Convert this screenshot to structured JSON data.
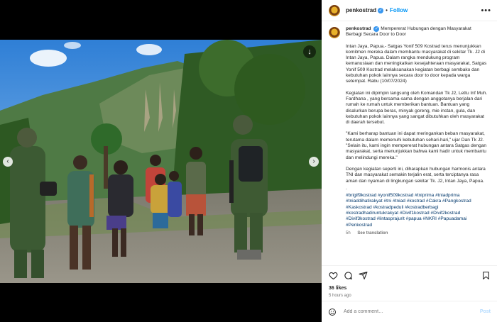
{
  "colors": {
    "accent": "#0095f6",
    "hashtag": "#00376b",
    "muted": "#737373"
  },
  "header": {
    "username": "penkostrad",
    "separator": "•",
    "follow_label": "Follow",
    "more_icon": "more-horizontal-icon"
  },
  "media": {
    "prev_icon": "chevron-left-icon",
    "next_icon": "chevron-right-icon",
    "download_icon": "download-icon"
  },
  "caption": {
    "username": "penkostrad",
    "title": "Mempererat Hubungan dengan Masyarakat Berbagi Secara Door to Door",
    "paragraph1": "Intan Jaya, Papua.- Satgas Yonif 509 Kostrad terus menunjukkan komitmen mereka dalam membantu masyarakat di sekitar Tk. J2 di Intan Jaya, Papua. Dalam rangka mendukung program kemanusiaan dan meningkatkan kesejahteraan masyarakat, Satgas Yonif 509 Kostrad melaksanakan kegiatan berbagi sembako dan kebutuhan pokok lainnya secara door to door kepada warga setempat. Rabu (10/07/2024)",
    "paragraph2": "Kegiatan ini dipimpin langsung oleh Komandan Tk J2, Lettu Inf Muh. Fardhana , yang bersama-sama dengan anggotanya berjalan dari rumah ke rumah untuk memberikan bantuan. Bantuan yang disalurkan berupa beras, minyak goreng, mie instan, gula, dan kebutuhan pokok lainnya yang sangat dibutuhkan oleh masyarakat di daerah tersebut.",
    "paragraph3": "\"Kami berharap bantuan ini dapat meringankan beban masyarakat, terutama dalam memenuhi kebutuhan sehari-hari,\" ujar Dan Tk J2. \"Selain itu, kami ingin mempererat hubungan antara Satgas dengan masyarakat, serta menunjukkan bahwa kami hadir untuk membantu dan melindungi mereka.\"",
    "paragraph4": "Dengan kegiatan seperti ini, diharapkan hubungan harmonis antara TNI dan masyarakat semakin terjalin erat, serta terciptanya rasa aman dan nyaman di lingkungan sekitar Tk. J2, Intan Jaya, Papua.",
    "dot": ".",
    "hashtags": "#brigif9kostrad #yonif509kostrad #tniprima #tniadprima #tniaddihatirakyat #tni #tniad #kostrad #Cakra #Pangkostrad #Kaskostrad #kostradpeduli #kostradberbagi #kostradhadiruntukrakyat #Divif1kostrad #Divif2kostrad #Divif3kostrad #lintasprajurit #papua #NKRI #Papuadamai #Penkostrad",
    "age": "5h",
    "see_translation": "See translation"
  },
  "actions": {
    "like_icon": "heart-icon",
    "comment_icon": "comment-icon",
    "share_icon": "share-icon",
    "save_icon": "bookmark-icon"
  },
  "likes": "36 likes",
  "time_ago": "5 hours ago",
  "comment": {
    "placeholder": "Add a comment…",
    "post_label": "Post",
    "emoji_icon": "emoji-icon"
  }
}
